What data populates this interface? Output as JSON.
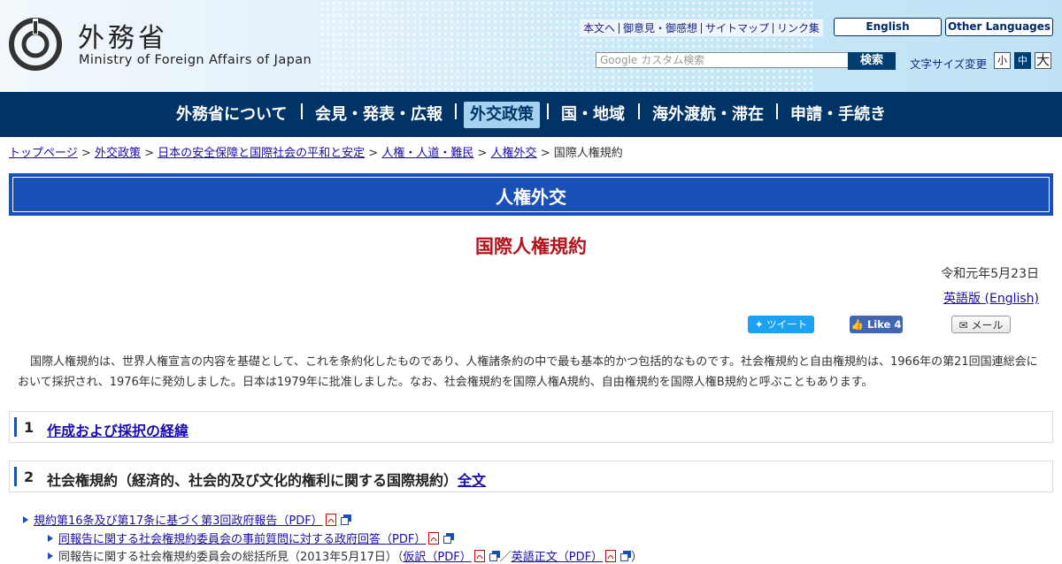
{
  "header": {
    "logo_jp": "外務省",
    "logo_en": "Ministry of Foreign Affairs of Japan",
    "util_links": [
      "本文へ",
      "御意見・御感想",
      "サイトマップ",
      "リンク集"
    ],
    "lang_english": "English",
    "lang_other": "Other Languages",
    "search_placeholder": "Google カスタム検索",
    "search_button": "検索",
    "fontsize_label": "文字サイズ変更",
    "fontsize_small": "小",
    "fontsize_medium": "中",
    "fontsize_large": "大"
  },
  "nav": {
    "items": [
      "外務省について",
      "会見・発表・広報",
      "外交政策",
      "国・地域",
      "海外渡航・滞在",
      "申請・手続き"
    ],
    "active": "外交政策"
  },
  "breadcrumb": {
    "links": [
      "トップページ",
      "外交政策",
      "日本の安全保障と国際社会の平和と安定",
      "人権・人道・難民",
      "人権外交"
    ],
    "separator": ">",
    "current": "国際人権規約"
  },
  "section_band": "人権外交",
  "page_title": "国際人権規約",
  "date": "令和元年5月23日",
  "english_link": "英語版 (English)",
  "social": {
    "tweet": "ツイート",
    "like": "Like 4",
    "mail": "メール"
  },
  "intro": "国際人権規約は、世界人権宣言の内容を基礎として、これを条約化したものであり、人権諸条約の中で最も基本的かつ包括的なものです。社会権規約と自由権規約は、1966年の第21回国連総会において採択され、1976年に発効しました。日本は1979年に批准しました。なお、社会権規約を国際人権A規約、自由権規約を国際人権B規約と呼ぶこともあります。",
  "sections": [
    {
      "num": "1",
      "link": "作成および採択の経緯"
    },
    {
      "num": "2",
      "text": "社会権規約（経済的、社会的及び文化的権利に関する国際規約）",
      "link": "全文"
    }
  ],
  "list": [
    {
      "text": "規約第16条及び第17条に基づく第3回政府報告（PDF）"
    },
    {
      "text": "同報告に関する社会権規約委員会の事前質問に対する政府回答（PDF）"
    },
    {
      "text_pre": "同報告に関する社会権規約委員会の総括所見（2013年5月17日）（",
      "link1": "仮訳（PDF）",
      "mid": "／",
      "link2": "英語正文（PDF）",
      "post": "）"
    }
  ]
}
